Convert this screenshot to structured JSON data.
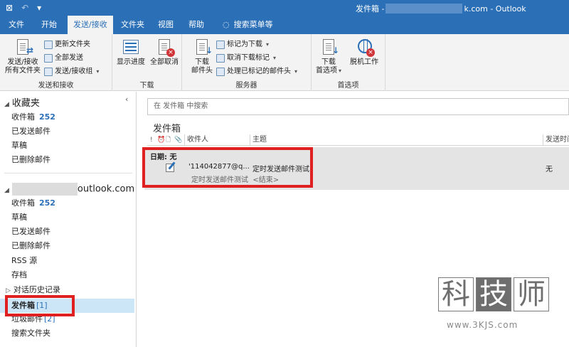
{
  "titlebar": {
    "title_prefix": "发件箱 -",
    "title_suffix": "k.com - Outlook"
  },
  "tabs": [
    "文件",
    "开始",
    "发送/接收",
    "文件夹",
    "视图",
    "帮助",
    "搜索菜单等"
  ],
  "ribbon": {
    "group1": {
      "big_label_1": "发送/接收",
      "big_label_2": "所有文件夹",
      "small_1": "更新文件夹",
      "small_2": "全部发送",
      "small_3": "发送/接收组",
      "label": "发送和接收"
    },
    "group2": {
      "big1": "显示进度",
      "big2": "全部取消",
      "label": "下载"
    },
    "group3": {
      "big_label_1": "下载",
      "big_label_2": "邮件头",
      "small_1": "标记为下载",
      "small_2": "取消下载标记",
      "small_3": "处理已标记的邮件头",
      "label": "服务器"
    },
    "group4": {
      "big1_line1": "下载",
      "big1_line2": "首选项",
      "big2": "脱机工作",
      "label": "首选项"
    }
  },
  "leftnav": {
    "favorites_header": "收藏夹",
    "favorites": [
      {
        "label": "收件箱",
        "count": "252"
      },
      {
        "label": "已发送邮件"
      },
      {
        "label": "草稿"
      },
      {
        "label": "已删除邮件"
      }
    ],
    "account_suffix": "outlook.com",
    "account_items": [
      {
        "label": "收件箱",
        "count": "252"
      },
      {
        "label": "草稿"
      },
      {
        "label": "已发送邮件"
      },
      {
        "label": "已删除邮件"
      },
      {
        "label": "RSS 源"
      },
      {
        "label": "存档"
      },
      {
        "label": "对话历史记录"
      },
      {
        "label": "发件箱",
        "count": "[1]"
      },
      {
        "label": "垃圾邮件",
        "count": "[2]"
      },
      {
        "label": "搜索文件夹"
      }
    ]
  },
  "content": {
    "search_placeholder": "在 发件箱 中搜索",
    "folder_title": "发件箱",
    "columns": {
      "importance": "!",
      "reminder": "⏰",
      "doc": "🗋",
      "attach": "📎",
      "to": "收件人",
      "subject": "主题",
      "sent": "发送时间"
    },
    "group_label": "日期: 无",
    "row": {
      "to": "'114042877@q...",
      "subject": "定时发送邮件测试",
      "preview": "定时发送邮件测试",
      "preview_end": "<结束>",
      "sent": "无"
    }
  },
  "watermark": {
    "chars": [
      "科",
      "技",
      "师"
    ],
    "url": "www.3KJS.com"
  }
}
